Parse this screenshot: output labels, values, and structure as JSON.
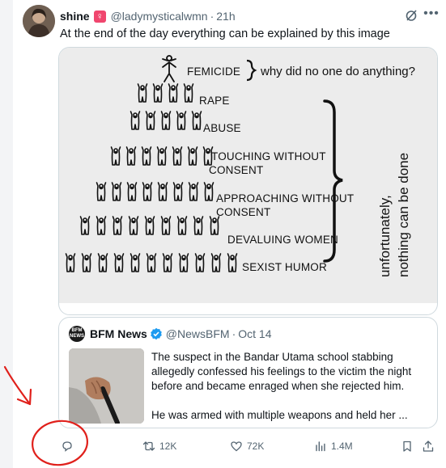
{
  "tweet": {
    "author": {
      "display_name": "shine",
      "gender_icon": "venus-icon",
      "handle": "@ladymysticalwmn",
      "time": "21h"
    },
    "text": "At the end of the day everything can be explained by this image",
    "media": {
      "pyramid_levels": [
        "FEMICIDE",
        "RAPE",
        "ABUSE",
        "TOUCHING WITHOUT",
        "CONSENT",
        "APPROACHING WITHOUT",
        "CONSENT",
        "DEVALUING WOMEN",
        "SEXIST HUMOR"
      ],
      "top_caption": "why did no one do anything?",
      "side_caption_line1": "unfortunately,",
      "side_caption_line2": "nothing can be done"
    },
    "quote": {
      "logo_text_1": "BFM",
      "logo_text_2": "NEWS",
      "display_name": "BFM News",
      "handle": "@NewsBFM",
      "date": "Oct 14",
      "paragraph1": "The suspect in the Bandar Utama school stabbing allegedly confessed his feelings to the victim the night before and became enraged when she rejected him.",
      "paragraph2": "He was armed with multiple weapons and held her ..."
    },
    "actions": {
      "reply_count": "",
      "retweet_count": "12K",
      "like_count": "72K",
      "views_count": "1.4M"
    }
  },
  "colors": {
    "text": "#0f1419",
    "secondary": "#536471",
    "annotation_red": "#e0201b",
    "verified_blue": "#1d9bf0"
  }
}
